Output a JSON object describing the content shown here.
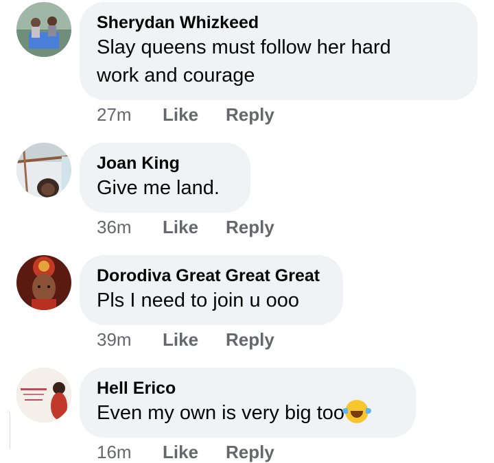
{
  "comments": [
    {
      "author": "Sherydan Whizkeed",
      "text_line1": "Slay queens must follow her hard",
      "text_line2": "work and courage",
      "time": "27m",
      "like_label": "Like",
      "reply_label": "Reply"
    },
    {
      "author": "Joan King",
      "text_line1": "Give me land.",
      "time": "36m",
      "like_label": "Like",
      "reply_label": "Reply"
    },
    {
      "author": "Dorodiva Great Great Great",
      "text_line1": "Pls I need to join u ooo",
      "time": "39m",
      "like_label": "Like",
      "reply_label": "Reply"
    },
    {
      "author": "Hell Erico",
      "text_line1": "Even my own is very big too",
      "emoji": "tears-of-joy-emoji",
      "time": "16m",
      "like_label": "Like",
      "reply_label": "Reply"
    }
  ],
  "colors": {
    "bubble_bg": "#f0f2f5",
    "meta_text": "#65676b",
    "text": "#050505"
  }
}
